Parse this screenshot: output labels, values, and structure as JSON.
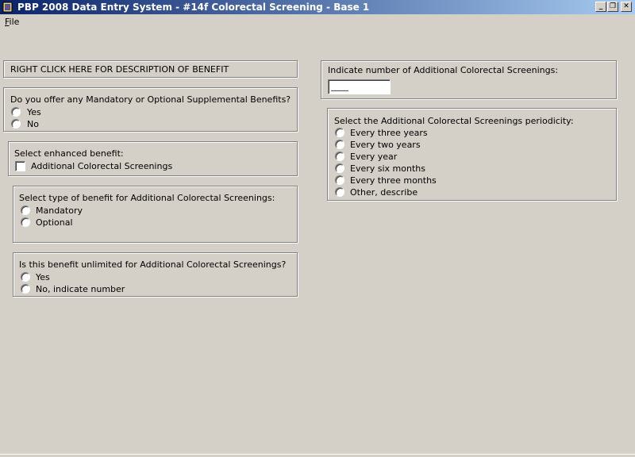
{
  "window": {
    "title": "PBP 2008 Data Entry System - #14f Colorectal Screening - Base 1",
    "minimize_glyph": "_",
    "restore_glyph": "❐",
    "close_glyph": "✕"
  },
  "menu": {
    "file_label": "File"
  },
  "left": {
    "description_link": "RIGHT CLICK HERE FOR DESCRIPTION OF BENEFIT",
    "offer_question": "Do you offer any Mandatory or Optional Supplemental Benefits?",
    "offer_options": [
      "Yes",
      "No"
    ],
    "enhanced_label": "Select enhanced benefit:",
    "enhanced_option": "Additional Colorectal Screenings",
    "type_question": "Select type of benefit for Additional Colorectal Screenings:",
    "type_options": [
      "Mandatory",
      "Optional"
    ],
    "unlimited_question": "Is this benefit unlimited for Additional Colorectal Screenings?",
    "unlimited_options": [
      "Yes",
      "No, indicate number"
    ]
  },
  "right": {
    "number_label": "Indicate number of Additional Colorectal Screenings:",
    "number_value": "____",
    "periodicity_label": "Select the Additional Colorectal Screenings periodicity:",
    "periodicity_options": [
      "Every three years",
      "Every two years",
      "Every year",
      "Every six months",
      "Every three months",
      "Other, describe"
    ]
  }
}
